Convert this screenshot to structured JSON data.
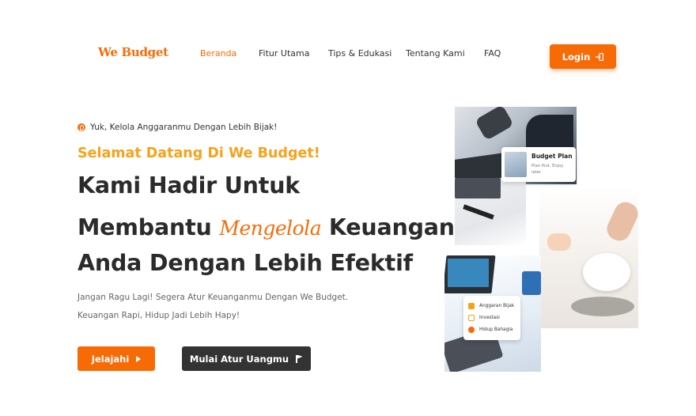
{
  "brand": {
    "logo_text": "We Budget",
    "accent": "#f76b07",
    "accent_light": "#f7a21a",
    "dark": "#333333"
  },
  "nav": {
    "items": [
      {
        "label": "Beranda",
        "active": true
      },
      {
        "label": "Fitur Utama",
        "active": false
      },
      {
        "label": "Tips & Edukasi",
        "active": false
      },
      {
        "label": "Tentang Kami",
        "active": false
      },
      {
        "label": "FAQ",
        "active": false
      }
    ],
    "login_label": "Login",
    "login_icon": "login-icon"
  },
  "hero": {
    "tagline": "Yuk, Kelola Anggaranmu Dengan Lebih Bijak!",
    "tagline_icon": "location-pin-icon",
    "welcome": "Selamat Datang Di We Budget!",
    "headline_line1": "Kami Hadir Untuk",
    "headline_line2_a": "Membantu",
    "headline_line2_script": "Mengelola",
    "headline_line2_b": "Keuangan",
    "headline_line3": "Anda Dengan Lebih Efektif",
    "desc_line1": "Jangan Ragu Lagi! Segera Atur Keuanganmu Dengan We Budget.",
    "desc_line2": "Keuangan Rapi, Hidup Jadi Lebih Hapy!",
    "primary_button": "Jelajahi",
    "primary_button_icon": "play-icon",
    "secondary_button": "Mulai Atur Uangmu",
    "secondary_button_icon": "flag-icon"
  },
  "collage": {
    "budget_card": {
      "title": "Budget Plan",
      "subtitle": "Plan first, Enjoy later"
    },
    "menu_card": {
      "items": [
        {
          "label": "Anggaran Bijak",
          "icon": "chart-icon"
        },
        {
          "label": "Investasi",
          "icon": "bar-chart-icon"
        },
        {
          "label": "Hidup Bahagia",
          "icon": "smile-icon"
        }
      ]
    }
  }
}
